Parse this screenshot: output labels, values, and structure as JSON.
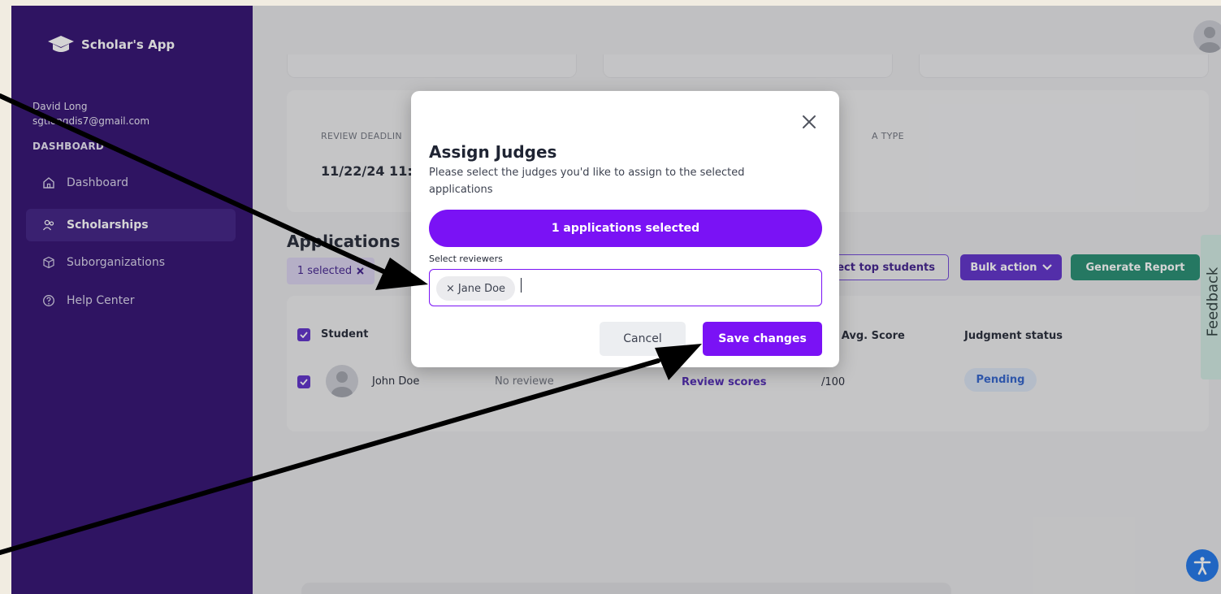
{
  "app": {
    "name": "Scholar's App"
  },
  "user": {
    "name": "David Long",
    "email": "sgtlongdis7@gmail.com"
  },
  "sidebar": {
    "section_label": "DASHBOARD",
    "items": [
      {
        "label": "Dashboard",
        "icon": "home-icon",
        "active": false
      },
      {
        "label": "Scholarships",
        "icon": "users-icon",
        "active": true
      },
      {
        "label": "Suborganizations",
        "icon": "cube-icon",
        "active": false
      },
      {
        "label": "Help Center",
        "icon": "help-circle-icon",
        "active": false
      }
    ]
  },
  "info": {
    "review_deadline_label": "REVIEW DEADLIN",
    "review_deadline_value": "11/22/24 11:5",
    "type_label": "A TYPE"
  },
  "applications": {
    "title": "Applications",
    "selected_chip": "1 selected",
    "select_top_label": "elect top students",
    "bulk_action_label": "Bulk action",
    "generate_report_label": "Generate Report",
    "columns": {
      "student": "Student",
      "avg_score": "al Avg. Score",
      "judgment": "Judgment status"
    },
    "rows": [
      {
        "student": "John Doe",
        "reviewers": "No reviewe",
        "review_link": "Review scores",
        "avg_score": "/100",
        "status": "Pending"
      }
    ]
  },
  "feedback_label": "Feedback",
  "modal": {
    "title": "Assign Judges",
    "description": "Please select the judges you'd like to assign to the selected applications",
    "selected_count_label": "1 applications selected",
    "select_reviewers_label": "Select reviewers",
    "tag_label": "Jane Doe",
    "tag_remove": "×",
    "cancel_label": "Cancel",
    "save_label": "Save changes"
  },
  "colors": {
    "sidebar": "#2c0a6d",
    "primary": "#7a12f5",
    "report": "#1f8a6d",
    "pending_text": "#2b5ec9"
  }
}
